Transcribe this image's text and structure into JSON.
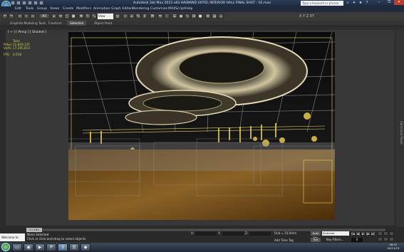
{
  "window": {
    "title": "Autodesk 3ds Max 2012 x64    HAIWAND HOTEL INTERIOR HALL FINAL SHOT - 02.max",
    "search_placeholder": "Type a keyword or phrase",
    "min_label": "–",
    "max_label": "❐",
    "close_label": "✕"
  },
  "menu": [
    "Edit",
    "Tools",
    "Group",
    "Views",
    "Create",
    "Modifiers",
    "Animation",
    "Graph Editors",
    "Rendering",
    "Customize",
    "MAXScript",
    "Help"
  ],
  "toolbar": {
    "reference_coord": "View",
    "axis_labels": "X  Y  Z  XY"
  },
  "ribbon": {
    "tabs": [
      "Graphite Modeling Tools",
      "Freeform",
      "Selection",
      "Object Paint"
    ],
    "active_tab": 2
  },
  "viewport": {
    "label": "[ + ] [ Persp ] [ Shaded ]",
    "stats": {
      "header": "Total",
      "polys_label": "Polys:",
      "polys_value": "22,829,125",
      "verts_label": "Verts:",
      "verts_value": "17,395,813",
      "fps_label": "FPS:",
      "fps_value": "0.558"
    }
  },
  "right_panel_label": "Command Panel",
  "status": {
    "maxscript": "Welcome to MAXScript.",
    "selection": "None Selected",
    "prompt": "Click or click-and-drag to select objects",
    "grid": "Grid = 10.0mm",
    "add_time_tag": "Add Time Tag",
    "auto_key": "Auto Key",
    "set_key": "Set Key",
    "selected": "Selected",
    "key_filters": "Key Filters...",
    "frame": "0",
    "time_slider": "0 / 100",
    "x_label": "X:",
    "y_label": "Y:",
    "z_label": "Z:"
  },
  "playback": [
    "|◄",
    "◄|",
    "►",
    "|►",
    "►|"
  ],
  "taskbar": {
    "clock_time": "06:07",
    "clock_date": "04/11/15"
  },
  "colors": {
    "accent": "#3a78c4",
    "stats_text": "#dfc94a"
  },
  "icons": {
    "app_logo": "3ds-max-logo",
    "start_button": "windows-start-orb"
  }
}
